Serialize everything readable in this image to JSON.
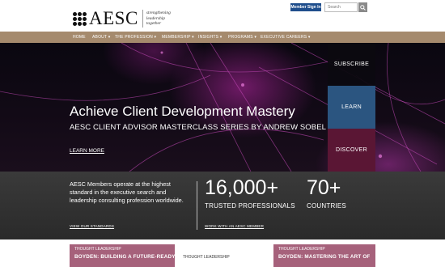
{
  "header": {
    "logo_text": "AESC",
    "tagline": [
      "strengthening",
      "leadership",
      "together"
    ],
    "member_sign_in": "Member Sign In",
    "search_placeholder": "Search"
  },
  "nav": {
    "items": [
      {
        "label": "HOME"
      },
      {
        "label": "ABOUT ▾"
      },
      {
        "label": "THE PROFESSION ▾"
      },
      {
        "label": "MEMBERSHIP ▾"
      },
      {
        "label": "INSIGHTS ▾"
      },
      {
        "label": "PROGRAMS ▾"
      },
      {
        "label": "EXECUTIVE CAREERS ▾"
      }
    ]
  },
  "hero": {
    "title": "Achieve Client Development Mastery",
    "subtitle": "AESC CLIENT ADVISOR MASTERCLASS SERIES BY ANDREW SOBEL",
    "link": "LEARN MORE",
    "panels": {
      "subscribe": "SUBSCRIBE",
      "learn": "LEARN",
      "discover": "DISCOVER"
    }
  },
  "stats": {
    "text": "AESC Members operate at the highest standard in the executive search and leadership consulting profession worldwide.",
    "standards_link": "VIEW OUR STANDARDS",
    "professionals": {
      "value": "16,000+",
      "label": "TRUSTED PROFESSIONALS",
      "link": "WORK WITH AN AESC MEMBER"
    },
    "countries": {
      "value": "70+",
      "label": "COUNTRIES"
    }
  },
  "cards": [
    {
      "tag": "THOUGHT LEADERSHIP",
      "title": "BOYDEN: BUILDING A FUTURE-READY"
    },
    {
      "tag": "THOUGHT LEADERSHIP"
    },
    {
      "tag": "THOUGHT LEADERSHIP",
      "title": "BOYDEN: MASTERING THE ART OF"
    }
  ],
  "colors": {
    "nav_bg": "#a58a6d",
    "member_btn": "#1f4e8c",
    "learn_panel": "#2b5580",
    "discover_panel": "#5a1634",
    "card_pink": "#a6617b"
  }
}
